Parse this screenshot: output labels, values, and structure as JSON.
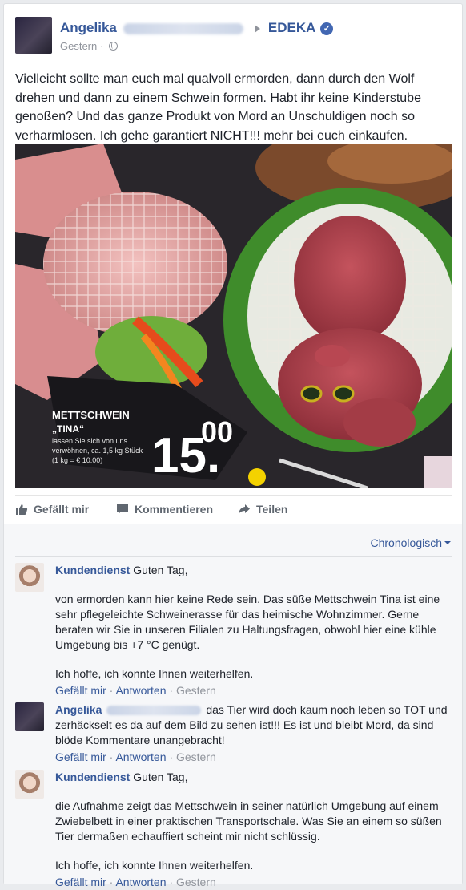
{
  "post": {
    "author": "Angelika",
    "page": "EDEKA",
    "verified_icon": "check-icon",
    "time": "Gestern",
    "privacy_icon": "globe-icon",
    "text": "Vielleicht sollte man euch mal qualvoll ermorden, dann durch den Wolf drehen und dann zu einem Schwein formen. Habt ihr keine Kinderstube genoßen? Und das ganze Produkt von Mord an Unschuldigen noch so verharmlosen. Ich gehe garantiert NICHT!!! mehr bei euch einkaufen.",
    "image": {
      "product_name": "METTSCHWEIN",
      "product_subname": "„TINA“",
      "desc_1": "lassen Sie sich von uns",
      "desc_2": "verwöhnen, ca. 1,5 kg Stück",
      "desc_3": "(1 kg = € 10.00)",
      "price_main": "15.",
      "price_cents": "00"
    }
  },
  "actions": {
    "like": "Gefällt mir",
    "comment": "Kommentieren",
    "share": "Teilen"
  },
  "comments_sort": "Chronologisch",
  "comments": [
    {
      "author": "Kundendienst",
      "first": "Guten Tag,",
      "paragraphs": [
        "von ermorden kann hier keine Rede sein. Das süße Mettschwein Tina ist eine sehr pflegeleichte Schweinerasse für das heimische Wohnzimmer. Gerne beraten wir Sie in unseren Filialen zu Haltungsfragen, obwohl hier eine kühle Umgebung bis +7 °C genügt.",
        "Ich hoffe, ich konnte Ihnen weiterhelfen."
      ],
      "like": "Gefällt mir",
      "reply": "Antworten",
      "time": "Gestern"
    },
    {
      "author": "Angelika",
      "first": "das Tier wird doch kaum noch leben so TOT und zerhäckselt es da auf dem Bild zu sehen ist!!! Es ist und bleibt Mord, da sind blöde Kommentare unangebracht!",
      "like": "Gefällt mir",
      "reply": "Antworten",
      "time": "Gestern"
    },
    {
      "author": "Kundendienst",
      "first": "Guten Tag,",
      "paragraphs": [
        "die Aufnahme zeigt das Mettschwein in seiner natürlich Umgebung auf einem Zwiebelbett in einer praktischen Transportschale. Was Sie an einem so süßen Tier dermaßen echauffiert scheint mir nicht schlüssig.",
        "Ich hoffe, ich konnte Ihnen weiterhelfen."
      ],
      "like": "Gefällt mir",
      "reply": "Antworten",
      "time": "Gestern"
    }
  ]
}
